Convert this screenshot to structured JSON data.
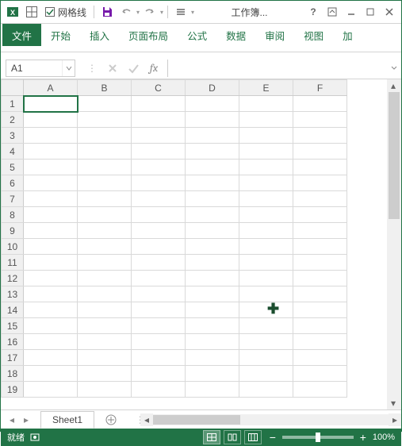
{
  "titlebar": {
    "gridlines_label": "网格线",
    "doc_title": "工作簿...",
    "help_label": "?"
  },
  "tabs": {
    "file": "文件",
    "home": "开始",
    "insert": "插入",
    "layout": "页面布局",
    "formulas": "公式",
    "data": "数据",
    "review": "审阅",
    "view": "视图",
    "addins": "加"
  },
  "namebox": {
    "value": "A1"
  },
  "formula": {
    "fx_label": "fx",
    "value": ""
  },
  "columns": [
    "A",
    "B",
    "C",
    "D",
    "E",
    "F"
  ],
  "rows": [
    "1",
    "2",
    "3",
    "4",
    "5",
    "6",
    "7",
    "8",
    "9",
    "10",
    "11",
    "12",
    "13",
    "14",
    "15",
    "16",
    "17",
    "18",
    "19"
  ],
  "sheet": {
    "name": "Sheet1",
    "add_tooltip": "+"
  },
  "status": {
    "ready": "就绪",
    "zoom": "100%"
  },
  "chart_data": null
}
